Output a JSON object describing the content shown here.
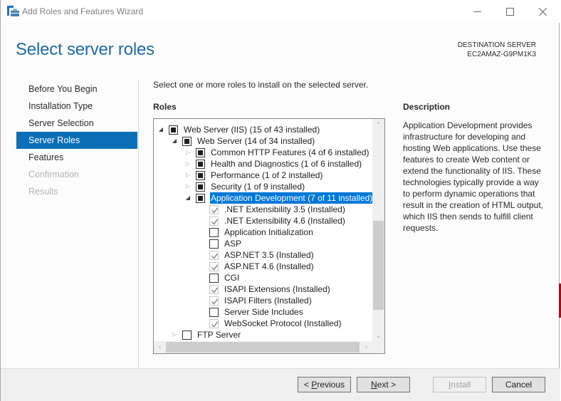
{
  "window": {
    "title": "Add Roles and Features Wizard",
    "icon": "server-manager-icon",
    "controls": [
      "minimize-icon",
      "maximize-icon",
      "close-icon"
    ]
  },
  "header": {
    "page_title": "Select server roles",
    "destination_label": "DESTINATION SERVER",
    "destination_server": "EC2AMAZ-G9PM1K3"
  },
  "nav": {
    "items": [
      {
        "label": "Before You Begin",
        "state": "normal"
      },
      {
        "label": "Installation Type",
        "state": "normal"
      },
      {
        "label": "Server Selection",
        "state": "normal"
      },
      {
        "label": "Server Roles",
        "state": "active"
      },
      {
        "label": "Features",
        "state": "normal"
      },
      {
        "label": "Confirmation",
        "state": "disabled"
      },
      {
        "label": "Results",
        "state": "disabled"
      }
    ]
  },
  "main": {
    "instruction": "Select one or more roles to install on the selected server.",
    "roles_label": "Roles",
    "description_label": "Description",
    "description_text": "Application Development provides infrastructure for developing and hosting Web applications. Use these features to create Web content or extend the functionality of IIS. These technologies typically provide a way to perform dynamic operations that result in the creation of HTML output, which IIS then sends to fulfill client requests."
  },
  "tree": {
    "rows": [
      {
        "label": "Web Server (IIS) (15 of 43 installed)",
        "level": 0,
        "expander": "expanded",
        "check": "indeterminate",
        "selected": false
      },
      {
        "label": "Web Server (14 of 34 installed)",
        "level": 1,
        "expander": "expanded",
        "check": "indeterminate",
        "selected": false
      },
      {
        "label": "Common HTTP Features (4 of 6 installed)",
        "level": 2,
        "expander": "collapsed",
        "check": "indeterminate",
        "selected": false
      },
      {
        "label": "Health and Diagnostics (1 of 6 installed)",
        "level": 2,
        "expander": "collapsed",
        "check": "indeterminate",
        "selected": false
      },
      {
        "label": "Performance (1 of 2 installed)",
        "level": 2,
        "expander": "collapsed",
        "check": "indeterminate",
        "selected": false
      },
      {
        "label": "Security (1 of 9 installed)",
        "level": 2,
        "expander": "collapsed",
        "check": "indeterminate",
        "selected": false
      },
      {
        "label": "Application Development (7 of 11 installed)",
        "level": 2,
        "expander": "expanded",
        "check": "indeterminate",
        "selected": true
      },
      {
        "label": ".NET Extensibility 3.5 (Installed)",
        "level": 3,
        "expander": "none",
        "check": "checked-disabled",
        "selected": false
      },
      {
        "label": ".NET Extensibility 4.6 (Installed)",
        "level": 3,
        "expander": "none",
        "check": "checked-disabled",
        "selected": false
      },
      {
        "label": "Application Initialization",
        "level": 3,
        "expander": "none",
        "check": "unchecked",
        "selected": false
      },
      {
        "label": "ASP",
        "level": 3,
        "expander": "none",
        "check": "unchecked",
        "selected": false
      },
      {
        "label": "ASP.NET 3.5 (Installed)",
        "level": 3,
        "expander": "none",
        "check": "checked-disabled",
        "selected": false
      },
      {
        "label": "ASP.NET 4.6 (Installed)",
        "level": 3,
        "expander": "none",
        "check": "checked-disabled",
        "selected": false
      },
      {
        "label": "CGI",
        "level": 3,
        "expander": "none",
        "check": "unchecked",
        "selected": false
      },
      {
        "label": "ISAPI Extensions (Installed)",
        "level": 3,
        "expander": "none",
        "check": "checked-disabled",
        "selected": false
      },
      {
        "label": "ISAPI Filters (Installed)",
        "level": 3,
        "expander": "none",
        "check": "checked-disabled",
        "selected": false
      },
      {
        "label": "Server Side Includes",
        "level": 3,
        "expander": "none",
        "check": "unchecked",
        "selected": false
      },
      {
        "label": "WebSocket Protocol (Installed)",
        "level": 3,
        "expander": "none",
        "check": "checked-disabled",
        "selected": false
      },
      {
        "label": "FTP Server",
        "level": 1,
        "expander": "collapsed",
        "check": "unchecked",
        "selected": false
      }
    ]
  },
  "footer": {
    "previous": {
      "prefix": "< ",
      "mnemonic": "P",
      "rest": "revious"
    },
    "next": {
      "mnemonic": "N",
      "rest": "ext >"
    },
    "install": {
      "mnemonic": "I",
      "rest": "nstall",
      "enabled": false
    },
    "cancel": {
      "label": "Cancel"
    }
  }
}
